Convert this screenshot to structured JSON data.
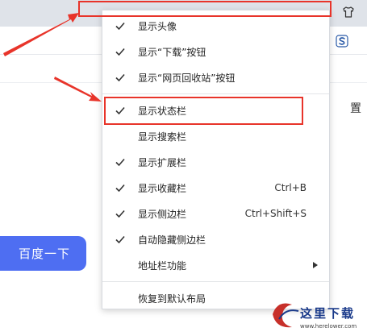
{
  "menu": {
    "items": [
      {
        "label": "显示头像",
        "checked": true,
        "shortcut": ""
      },
      {
        "label": "显示“下载”按钮",
        "checked": true,
        "shortcut": ""
      },
      {
        "label": "显示“网页回收站”按钮",
        "checked": true,
        "shortcut": ""
      },
      {
        "label": "显示状态栏",
        "checked": true,
        "shortcut": ""
      },
      {
        "label": "显示搜索栏",
        "checked": false,
        "shortcut": ""
      },
      {
        "label": "显示扩展栏",
        "checked": true,
        "shortcut": ""
      },
      {
        "label": "显示收藏栏",
        "checked": true,
        "shortcut": "Ctrl+B"
      },
      {
        "label": "显示侧边栏",
        "checked": true,
        "shortcut": "Ctrl+Shift+S"
      },
      {
        "label": "自动隐藏侧边栏",
        "checked": true,
        "shortcut": ""
      },
      {
        "label": "地址栏功能",
        "checked": false,
        "shortcut": "",
        "submenu": true
      },
      {
        "label": "恢复到默认布局",
        "checked": false,
        "shortcut": ""
      }
    ]
  },
  "page": {
    "search_button_label": "百度一下",
    "partial_text": "置"
  },
  "watermark": {
    "title": "这里下载",
    "url": "www.herelower.com"
  },
  "colors": {
    "highlight": "#e8342a",
    "search_button": "#4e6ef2",
    "watermark": "#1a3a8a"
  }
}
